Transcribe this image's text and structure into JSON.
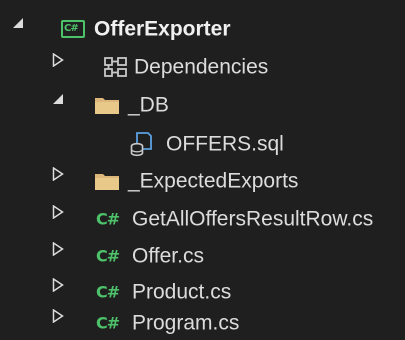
{
  "solution_explorer": {
    "project": {
      "name": "OfferExporter",
      "icon": "csharp-project-icon",
      "expanded": true
    },
    "items": [
      {
        "label": "Dependencies",
        "icon": "dependencies-icon",
        "expander": "collapsed"
      },
      {
        "label": "_DB",
        "icon": "folder-icon",
        "expander": "expanded"
      },
      {
        "label": "OFFERS.sql",
        "icon": "sql-file-icon",
        "expander": "none"
      },
      {
        "label": "_ExpectedExports",
        "icon": "folder-icon",
        "expander": "collapsed"
      },
      {
        "label": "GetAllOffersResultRow.cs",
        "icon": "csharp-file-icon",
        "expander": "collapsed"
      },
      {
        "label": "Offer.cs",
        "icon": "csharp-file-icon",
        "expander": "collapsed"
      },
      {
        "label": "Product.cs",
        "icon": "csharp-file-icon",
        "expander": "collapsed"
      },
      {
        "label": "Program.cs",
        "icon": "csharp-file-icon",
        "expander": "collapsed"
      }
    ],
    "cs_glyph": "C#",
    "colors": {
      "background": "#1f1f1f",
      "text": "#dcdcdc",
      "csharp_green": "#4ec26a",
      "folder": "#dcb67a"
    }
  }
}
